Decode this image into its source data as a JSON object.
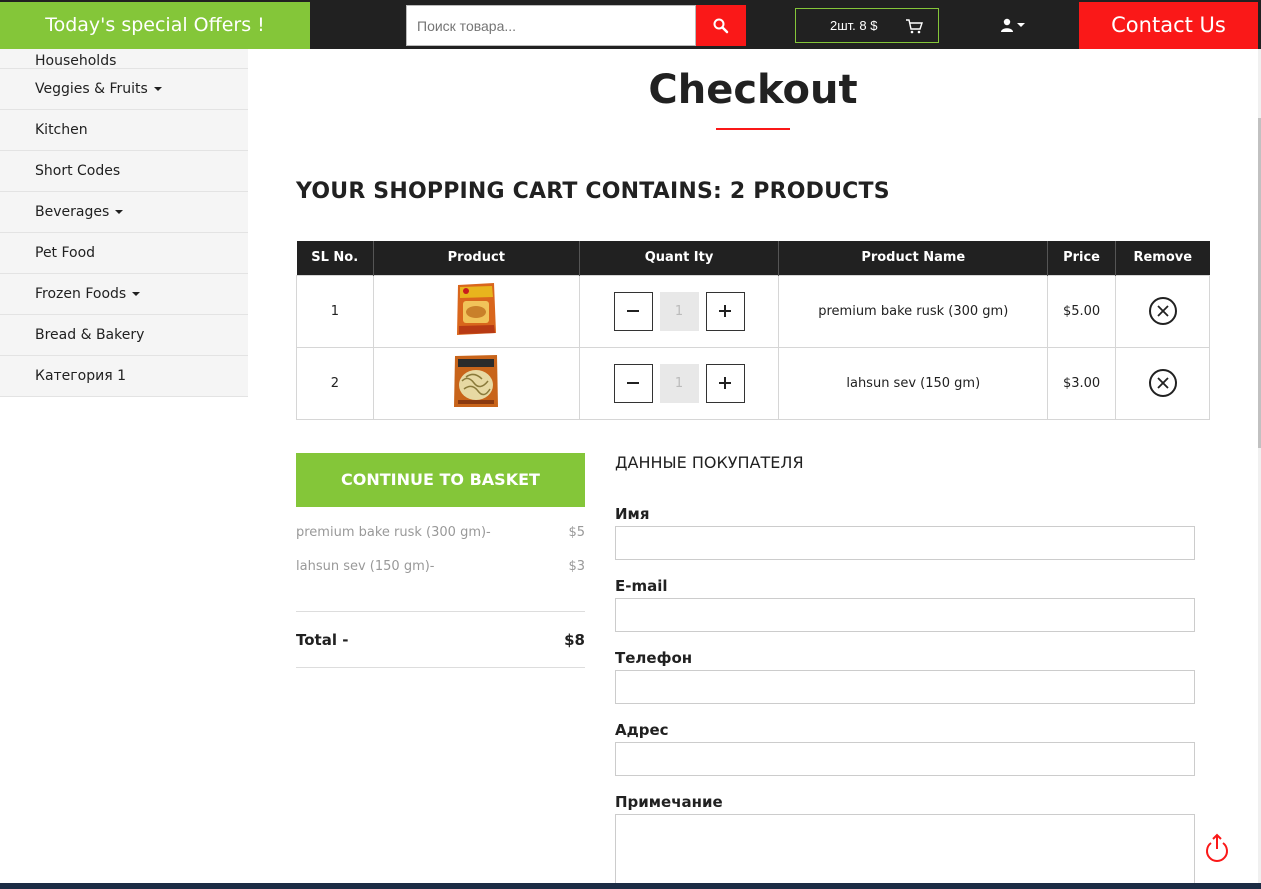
{
  "topbar": {
    "offers_label": "Today's special Offers !",
    "search_placeholder": "Поиск товара...",
    "cart_summary": "2шт. 8 $",
    "contact_label": "Contact Us"
  },
  "sidebar": {
    "items": [
      {
        "label": "Households",
        "has_caret": false
      },
      {
        "label": "Veggies & Fruits",
        "has_caret": true
      },
      {
        "label": "Kitchen",
        "has_caret": false
      },
      {
        "label": "Short Codes",
        "has_caret": false
      },
      {
        "label": "Beverages",
        "has_caret": true
      },
      {
        "label": "Pet Food",
        "has_caret": false
      },
      {
        "label": "Frozen Foods",
        "has_caret": true
      },
      {
        "label": "Bread & Bakery",
        "has_caret": false
      },
      {
        "label": "Категория 1",
        "has_caret": false
      }
    ]
  },
  "main": {
    "page_title": "Checkout",
    "cart_heading": "YOUR SHOPPING CART CONTAINS: 2 PRODUCTS",
    "table": {
      "headers": [
        "SL No.",
        "Product",
        "Quant Ity",
        "Product Name",
        "Price",
        "Remove"
      ],
      "rows": [
        {
          "sl": "1",
          "quantity": "1",
          "name": "premium bake rusk (300 gm)",
          "price": "$5.00"
        },
        {
          "sl": "2",
          "quantity": "1",
          "name": "lahsun sev (150 gm)",
          "price": "$3.00"
        }
      ]
    },
    "continue_label": "CONTINUE TO BASKET",
    "summary": {
      "items": [
        {
          "name": "premium bake rusk (300 gm)-",
          "price": "$5"
        },
        {
          "name": "lahsun sev (150 gm)-",
          "price": "$3"
        }
      ],
      "total_label": "Total -",
      "total_value": "$8"
    },
    "buyer": {
      "title": "ДАННЫЕ ПОКУПАТЕЛЯ",
      "name_label": "Имя",
      "email_label": "E-mail",
      "phone_label": "Телефон",
      "address_label": "Адрес",
      "note_label": "Примечание"
    }
  },
  "colors": {
    "green": "#84c639",
    "red": "#fa1818",
    "dark": "#212121"
  }
}
